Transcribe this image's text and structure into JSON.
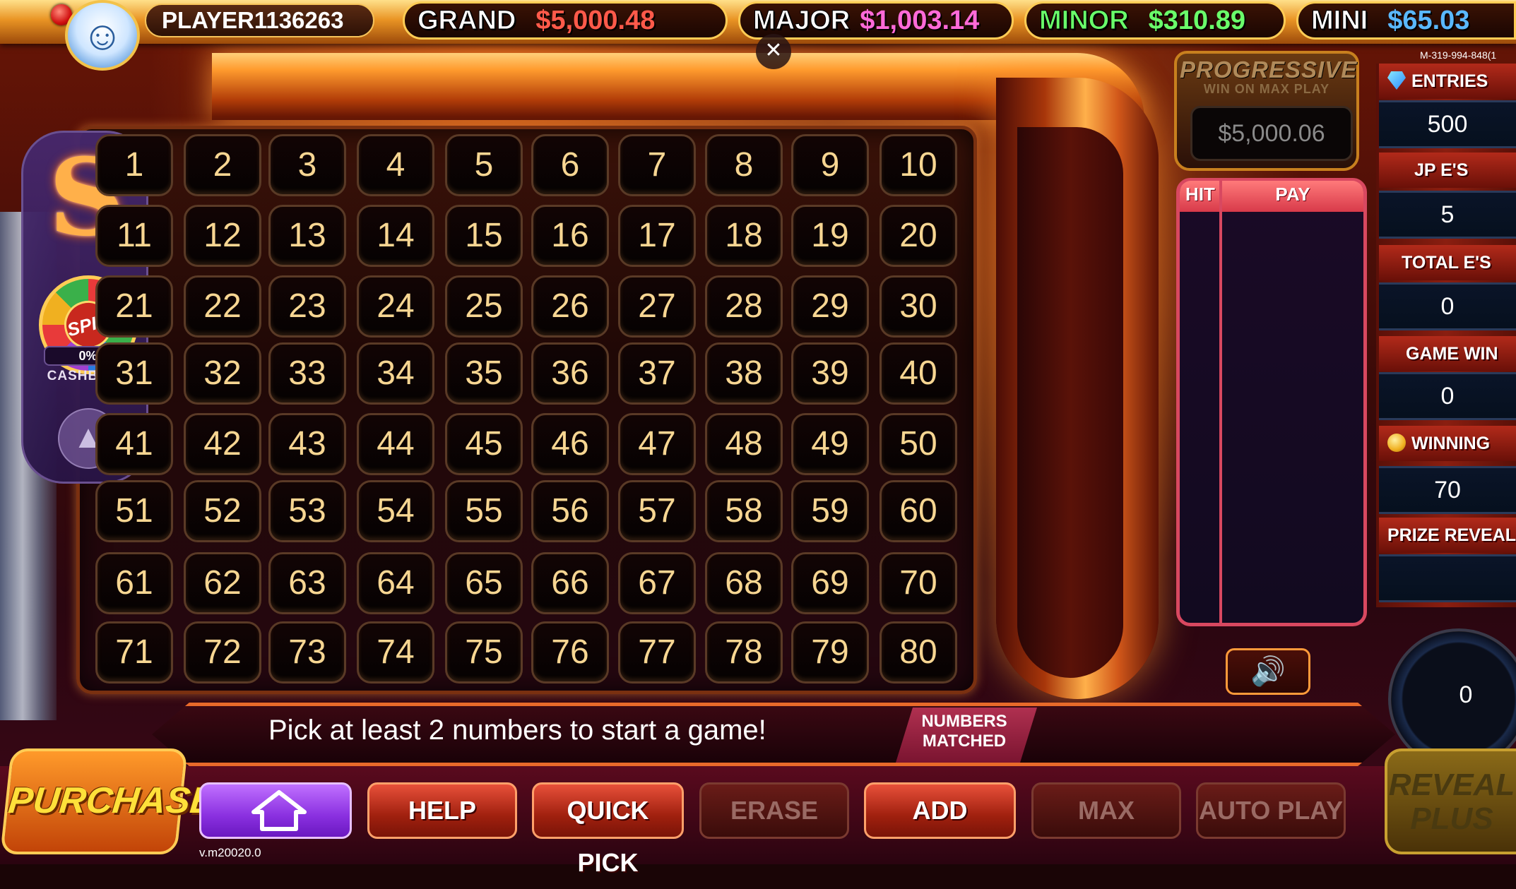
{
  "player": {
    "name": "PLAYER1136263"
  },
  "jackpots": {
    "grand": {
      "label": "GRAND",
      "value": "$5,000.48",
      "label_color": "#ffffff",
      "value_color": "#ff5a4a"
    },
    "major": {
      "label": "MAJOR",
      "value": "$1,003.14",
      "label_color": "#ffffff",
      "value_color": "#ff6ad8"
    },
    "minor": {
      "label": "MINOR",
      "value": "$310.89",
      "label_color": "#6aff6a",
      "value_color": "#6aff6a"
    },
    "mini": {
      "label": "MINI",
      "value": "$65.03",
      "label_color": "#ffffff",
      "value_color": "#5ab8ff"
    }
  },
  "close_icon": "close-icon",
  "machine_id": "M-319-994-848(1",
  "side_panel": {
    "cashback_pct": "0%",
    "cashback_label": "CASHBACK",
    "spin_label": "SPIN"
  },
  "board": {
    "numbers": [
      "1",
      "2",
      "3",
      "4",
      "5",
      "6",
      "7",
      "8",
      "9",
      "10",
      "11",
      "12",
      "13",
      "14",
      "15",
      "16",
      "17",
      "18",
      "19",
      "20",
      "21",
      "22",
      "23",
      "24",
      "25",
      "26",
      "27",
      "28",
      "29",
      "30",
      "31",
      "32",
      "33",
      "34",
      "35",
      "36",
      "37",
      "38",
      "39",
      "40",
      "41",
      "42",
      "43",
      "44",
      "45",
      "46",
      "47",
      "48",
      "49",
      "50",
      "51",
      "52",
      "53",
      "54",
      "55",
      "56",
      "57",
      "58",
      "59",
      "60",
      "61",
      "62",
      "63",
      "64",
      "65",
      "66",
      "67",
      "68",
      "69",
      "70",
      "71",
      "72",
      "73",
      "74",
      "75",
      "76",
      "77",
      "78",
      "79",
      "80"
    ]
  },
  "progressive": {
    "title": "PROGRESSIVE",
    "subtitle": "WIN ON MAX PLAY",
    "amount": "$5,000.06"
  },
  "paytable": {
    "hit_header": "HIT",
    "pay_header": "PAY"
  },
  "stats": {
    "entries_label": "ENTRIES",
    "entries_value": "500",
    "jp_label": "JP E'S",
    "jp_value": "5",
    "total_label": "TOTAL E'S",
    "total_value": "0",
    "game_win_label": "GAME WIN",
    "game_win_value": "0",
    "winning_label": "WINNING",
    "winning_value": "70",
    "prize_reveal_label": "PRIZE REVEAL",
    "prize_reveal_value": ""
  },
  "gauge": {
    "value": "0"
  },
  "message": {
    "text": "Pick at least 2 numbers to start a game!",
    "matched_line1": "NUMBERS",
    "matched_line2": "MATCHED"
  },
  "buttons": {
    "purchase": "PURCHASE",
    "help": "HELP",
    "quick_pick": "QUICK PICK",
    "erase": "ERASE",
    "add": "ADD",
    "max": "MAX",
    "auto_play": "AUTO PLAY",
    "reveal_line1": "REVEAL",
    "reveal_line2": "PLUS"
  },
  "version": "v.m20020.0"
}
